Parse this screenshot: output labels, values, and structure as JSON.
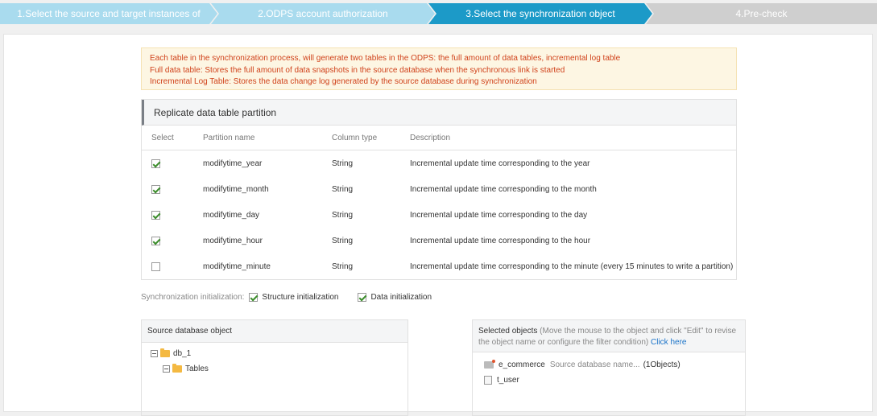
{
  "wizard": {
    "steps": [
      {
        "label": "1.Select the source and target instances of",
        "state": "done"
      },
      {
        "label": "2.ODPS account authorization",
        "state": "done"
      },
      {
        "label": "3.Select the synchronization object",
        "state": "active"
      },
      {
        "label": "4.Pre-check",
        "state": "pending"
      }
    ]
  },
  "notice": {
    "line1": "Each table in the synchronization process, will generate two tables in the ODPS: the full amount of data tables, incremental log table",
    "line2": "Full data table: Stores the full amount of data snapshots in the source database when the synchronous link is started",
    "line3": "Incremental Log Table: Stores the data change log generated by the source database during synchronization"
  },
  "partition_table": {
    "title": "Replicate data table partition",
    "columns": [
      "Select",
      "Partition name",
      "Column type",
      "Description"
    ],
    "rows": [
      {
        "checked": true,
        "name": "modifytime_year",
        "type": "String",
        "desc": "Incremental update time corresponding to the year"
      },
      {
        "checked": true,
        "name": "modifytime_month",
        "type": "String",
        "desc": "Incremental update time corresponding to the month"
      },
      {
        "checked": true,
        "name": "modifytime_day",
        "type": "String",
        "desc": "Incremental update time corresponding to the day"
      },
      {
        "checked": true,
        "name": "modifytime_hour",
        "type": "String",
        "desc": "Incremental update time corresponding to the hour"
      },
      {
        "checked": false,
        "name": "modifytime_minute",
        "type": "String",
        "desc": "Incremental update time corresponding to the minute (every 15 minutes to write a partition)"
      }
    ]
  },
  "sync_init": {
    "label": "Synchronization initialization:",
    "structure_label": "Structure initialization",
    "structure_checked": true,
    "data_label": "Data initialization",
    "data_checked": true
  },
  "source_objects": {
    "title": "Source database object",
    "db_name": "db_1",
    "tables_label": "Tables"
  },
  "selected_objects": {
    "title": "Selected objects",
    "hint": "(Move the mouse to the object and click \"Edit\" to revise the object name or configure the filter condition)",
    "link": "Click here",
    "db_name": "e_commerce",
    "db_sub": "Source database name...",
    "db_count": "(1Objects)",
    "table_name": "t_user"
  },
  "colors": {
    "step_done": "#a9dbee",
    "step_active": "#1c9ac8",
    "step_pending": "#cfcfcf",
    "notice_text": "#d0421b",
    "link": "#1a73c8",
    "check": "#3b8d2b"
  }
}
